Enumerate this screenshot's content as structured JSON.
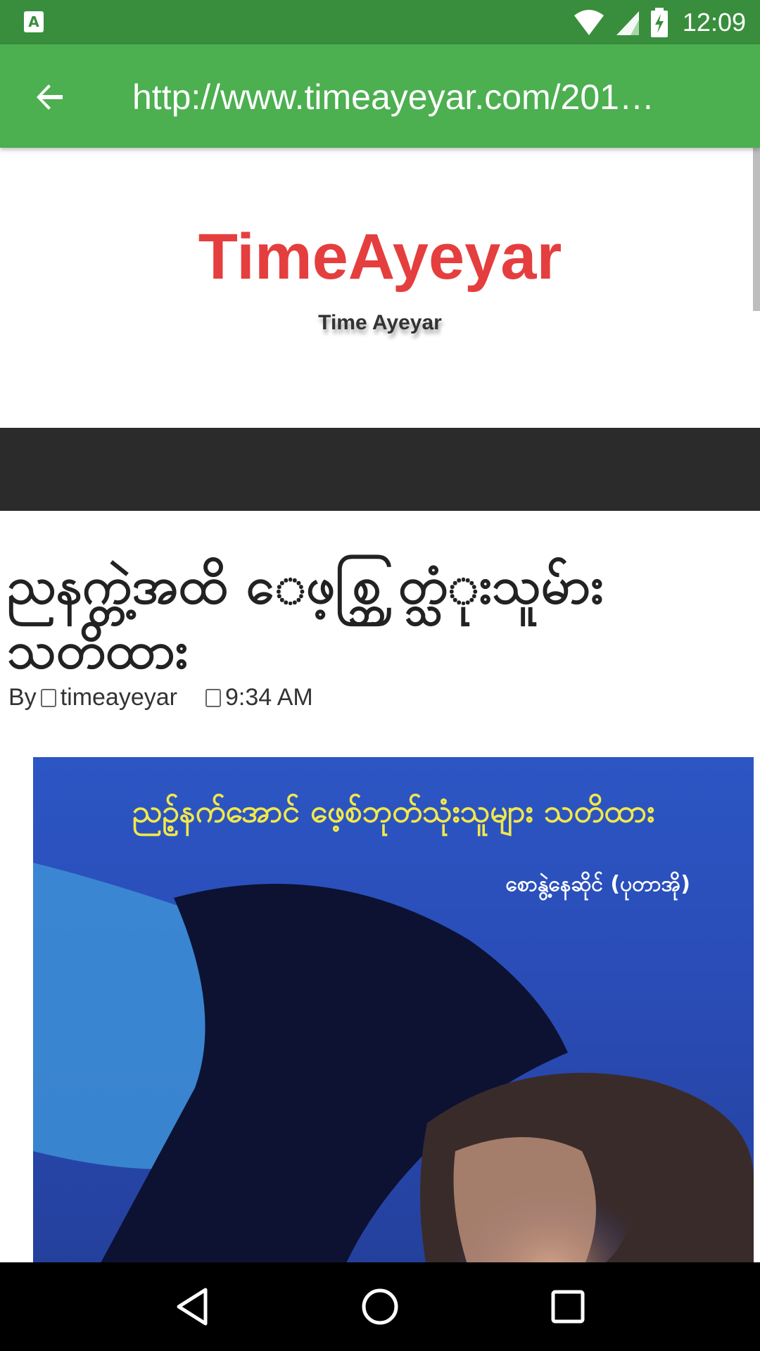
{
  "status_bar": {
    "left_icon": "a11y-notification-icon",
    "left_icon_text": "A",
    "time": "12:09",
    "icons": [
      "wifi-icon",
      "cell-signal-icon",
      "battery-charging-icon"
    ]
  },
  "app_bar": {
    "back_icon": "arrow-back-icon",
    "url": "http://www.timeayeyar.com/201…"
  },
  "site": {
    "title": "TimeAyeyar",
    "tagline": "Time Ayeyar"
  },
  "post": {
    "title": "ညနက္တဲ့အထိ ေဖ့စ္ဘြတ္သံုးသူမ်ား သတိထား",
    "by_label": "By",
    "author_icon": "",
    "author": "timeayeyar",
    "time_icon": "",
    "time": "9:34 AM",
    "image": {
      "headline": "ညဉ့်နက်အောင် ဖေ့စ်ဘုတ်သုံးသူများ သတိထား",
      "byline": "စောနွဲ့နေဆိုင် (ပုတာအို)"
    }
  },
  "colors": {
    "status_bar": "#388e3c",
    "app_bar": "#4caf50",
    "site_title": "#e53e3e",
    "nav_strip": "#2b2b2b"
  },
  "system_nav": {
    "back": "nav-back-icon",
    "home": "nav-home-icon",
    "recents": "nav-recents-icon"
  }
}
